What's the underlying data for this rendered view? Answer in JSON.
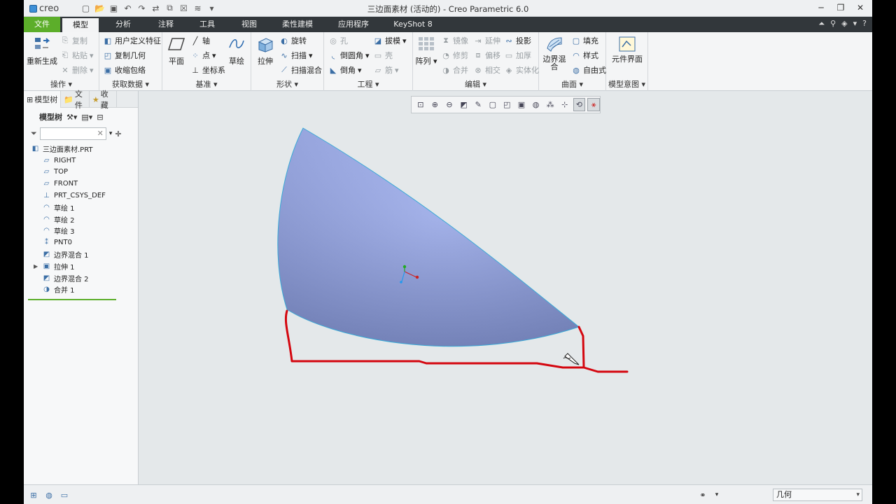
{
  "window": {
    "title": "三边面素材 (活动的) - Creo Parametric 6.0",
    "logo_text": "creo"
  },
  "tabs": [
    "文件",
    "模型",
    "分析",
    "注释",
    "工具",
    "视图",
    "柔性建模",
    "应用程序",
    "KeyShot 8"
  ],
  "ribbon": {
    "operations": {
      "label": "操作",
      "regenerate": "重新生成",
      "copy": "复制",
      "paste": "粘贴",
      "delete": "删除"
    },
    "get_data": {
      "label": "获取数据",
      "udf": "用户定义特征",
      "copy_geom": "复制几何",
      "shrinkwrap": "收缩包络"
    },
    "datum": {
      "label": "基准",
      "plane": "平面",
      "axis": "轴",
      "point": "点",
      "csys": "坐标系",
      "sketch": "草绘"
    },
    "shapes": {
      "label": "形状",
      "extrude": "拉伸",
      "revolve": "旋转",
      "sweep": "扫描",
      "swept_blend": "扫描混合"
    },
    "engineering": {
      "label": "工程",
      "hole": "孔",
      "round": "倒圆角",
      "chamfer": "倒角",
      "draft": "拔模",
      "shell": "壳",
      "rib": "筋"
    },
    "editing": {
      "label": "编辑",
      "pattern": "阵列",
      "mirror": "镜像",
      "trim": "修剪",
      "merge": "合并",
      "extend": "延伸",
      "offset": "偏移",
      "intersect": "相交",
      "project": "投影",
      "thicken": "加厚",
      "solidify": "实体化"
    },
    "surfaces": {
      "label": "曲面",
      "boundary_blend": "边界混合",
      "fill": "填充",
      "style": "样式",
      "freestyle": "自由式"
    },
    "model_intent": {
      "label": "模型意图",
      "component_interface": "元件界面"
    }
  },
  "left_panel": {
    "tabs": [
      "模型树",
      "文件",
      "收藏"
    ],
    "tree_label": "模型树",
    "items": [
      {
        "label": "三边面素材.PRT",
        "icon": "part-icon",
        "indent": 0
      },
      {
        "label": "RIGHT",
        "icon": "datum-plane-icon",
        "indent": 1
      },
      {
        "label": "TOP",
        "icon": "datum-plane-icon",
        "indent": 1
      },
      {
        "label": "FRONT",
        "icon": "datum-plane-icon",
        "indent": 1
      },
      {
        "label": "PRT_CSYS_DEF",
        "icon": "csys-icon",
        "indent": 1
      },
      {
        "label": "草绘 1",
        "icon": "sketch-icon",
        "indent": 1
      },
      {
        "label": "草绘 2",
        "icon": "sketch-icon",
        "indent": 1
      },
      {
        "label": "草绘 3",
        "icon": "sketch-icon",
        "indent": 1
      },
      {
        "label": "PNT0",
        "icon": "datum-point-icon",
        "indent": 1
      },
      {
        "label": "边界混合 1",
        "icon": "boundary-blend-icon",
        "indent": 1
      },
      {
        "label": "拉伸 1",
        "icon": "extrude-icon",
        "indent": 1,
        "expandable": true
      },
      {
        "label": "边界混合 2",
        "icon": "boundary-blend-icon",
        "indent": 1
      },
      {
        "label": "合并 1",
        "icon": "merge-icon",
        "indent": 1
      }
    ]
  },
  "statusbar": {
    "selection_filter": "几何"
  },
  "colors": {
    "surface_top": "#a8b8f8",
    "surface_bottom": "#7f8fcc",
    "surface_edge": "#39a9d6",
    "sketch_red": "#d4060f",
    "file_tab": "#5cae2a"
  }
}
